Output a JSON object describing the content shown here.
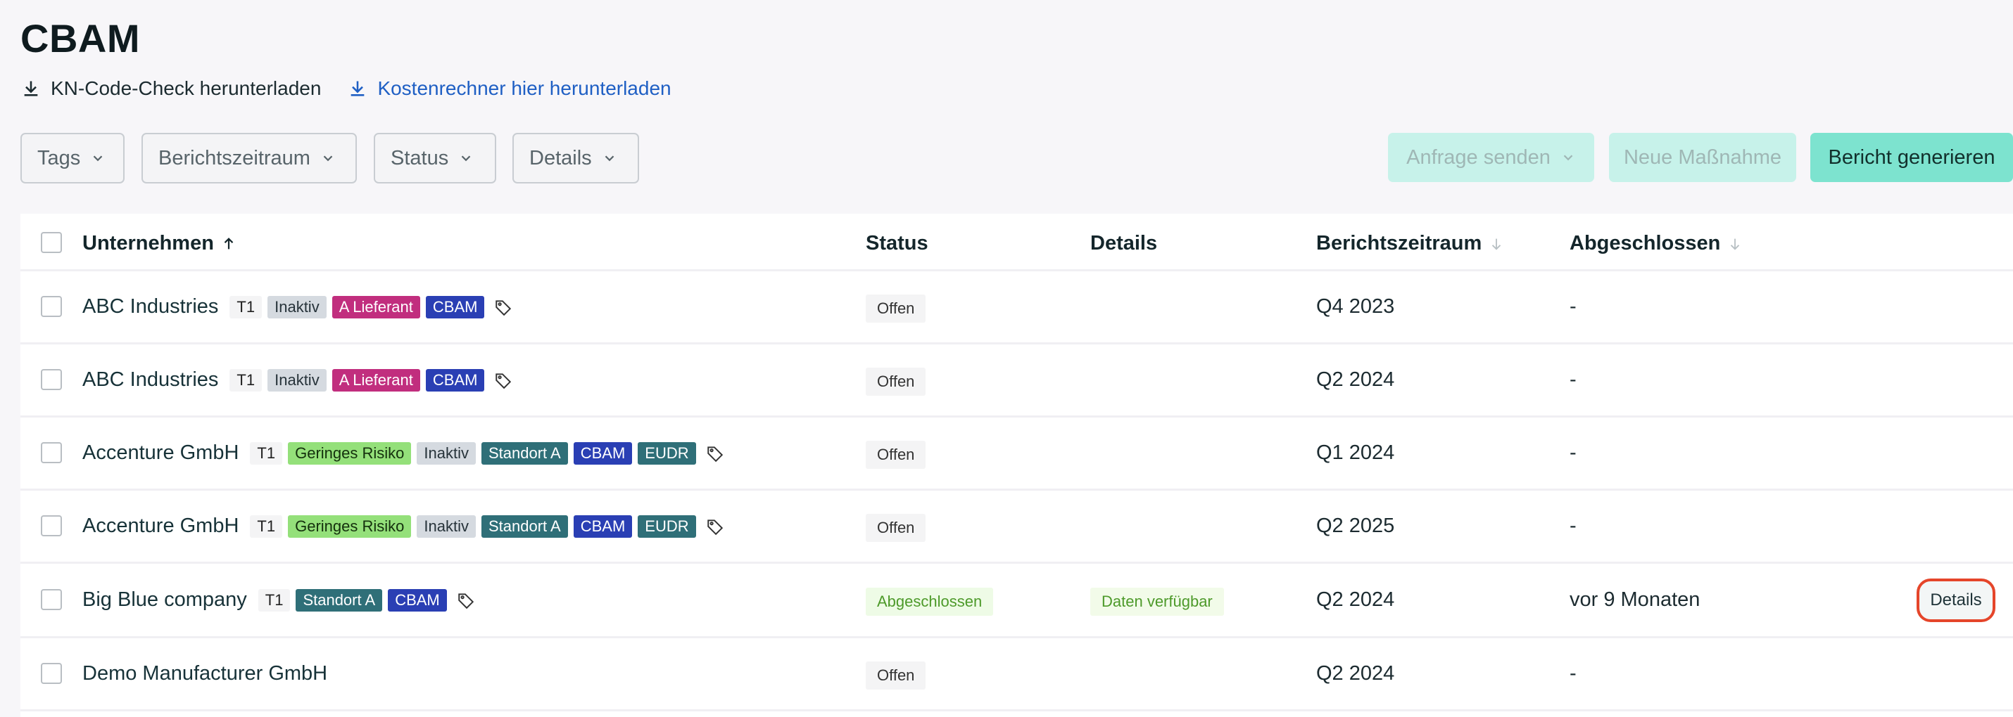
{
  "page": {
    "title": "CBAM"
  },
  "downloads": {
    "kn_code_check": "KN-Code-Check herunterladen",
    "cost_calculator": "Kostenrechner hier herunterladen"
  },
  "filters": {
    "tags": "Tags",
    "period": "Berichtszeitraum",
    "status": "Status",
    "details": "Details"
  },
  "actions": {
    "send_request": "Anfrage senden",
    "new_measure": "Neue Maßnahme",
    "generate_report": "Bericht generieren"
  },
  "table": {
    "columns": {
      "company": "Unternehmen",
      "status": "Status",
      "details": "Details",
      "period": "Berichtszeitraum",
      "closed": "Abgeschlossen"
    },
    "rows": [
      {
        "company": "ABC Industries",
        "tags": [
          "T1",
          "Inaktiv",
          "A Lieferant",
          "CBAM"
        ],
        "status": "Offen",
        "details": "",
        "period": "Q4 2023",
        "closed": "-"
      },
      {
        "company": "ABC Industries",
        "tags": [
          "T1",
          "Inaktiv",
          "A Lieferant",
          "CBAM"
        ],
        "status": "Offen",
        "details": "",
        "period": "Q2 2024",
        "closed": "-"
      },
      {
        "company": "Accenture GmbH",
        "tags": [
          "T1",
          "Geringes Risiko",
          "Inaktiv",
          "Standort A",
          "CBAM",
          "EUDR"
        ],
        "status": "Offen",
        "details": "",
        "period": "Q1 2024",
        "closed": "-"
      },
      {
        "company": "Accenture GmbH",
        "tags": [
          "T1",
          "Geringes Risiko",
          "Inaktiv",
          "Standort A",
          "CBAM",
          "EUDR"
        ],
        "status": "Offen",
        "details": "",
        "period": "Q2 2025",
        "closed": "-"
      },
      {
        "company": "Big Blue company",
        "tags": [
          "T1",
          "Standort A",
          "CBAM"
        ],
        "status": "Abgeschlossen",
        "details": "Daten verfügbar",
        "period": "Q2 2024",
        "closed": "vor 9 Monaten",
        "action": "Details"
      },
      {
        "company": "Demo Manufacturer GmbH",
        "tags": [],
        "status": "Offen",
        "details": "",
        "period": "Q2 2024",
        "closed": "-"
      }
    ]
  }
}
